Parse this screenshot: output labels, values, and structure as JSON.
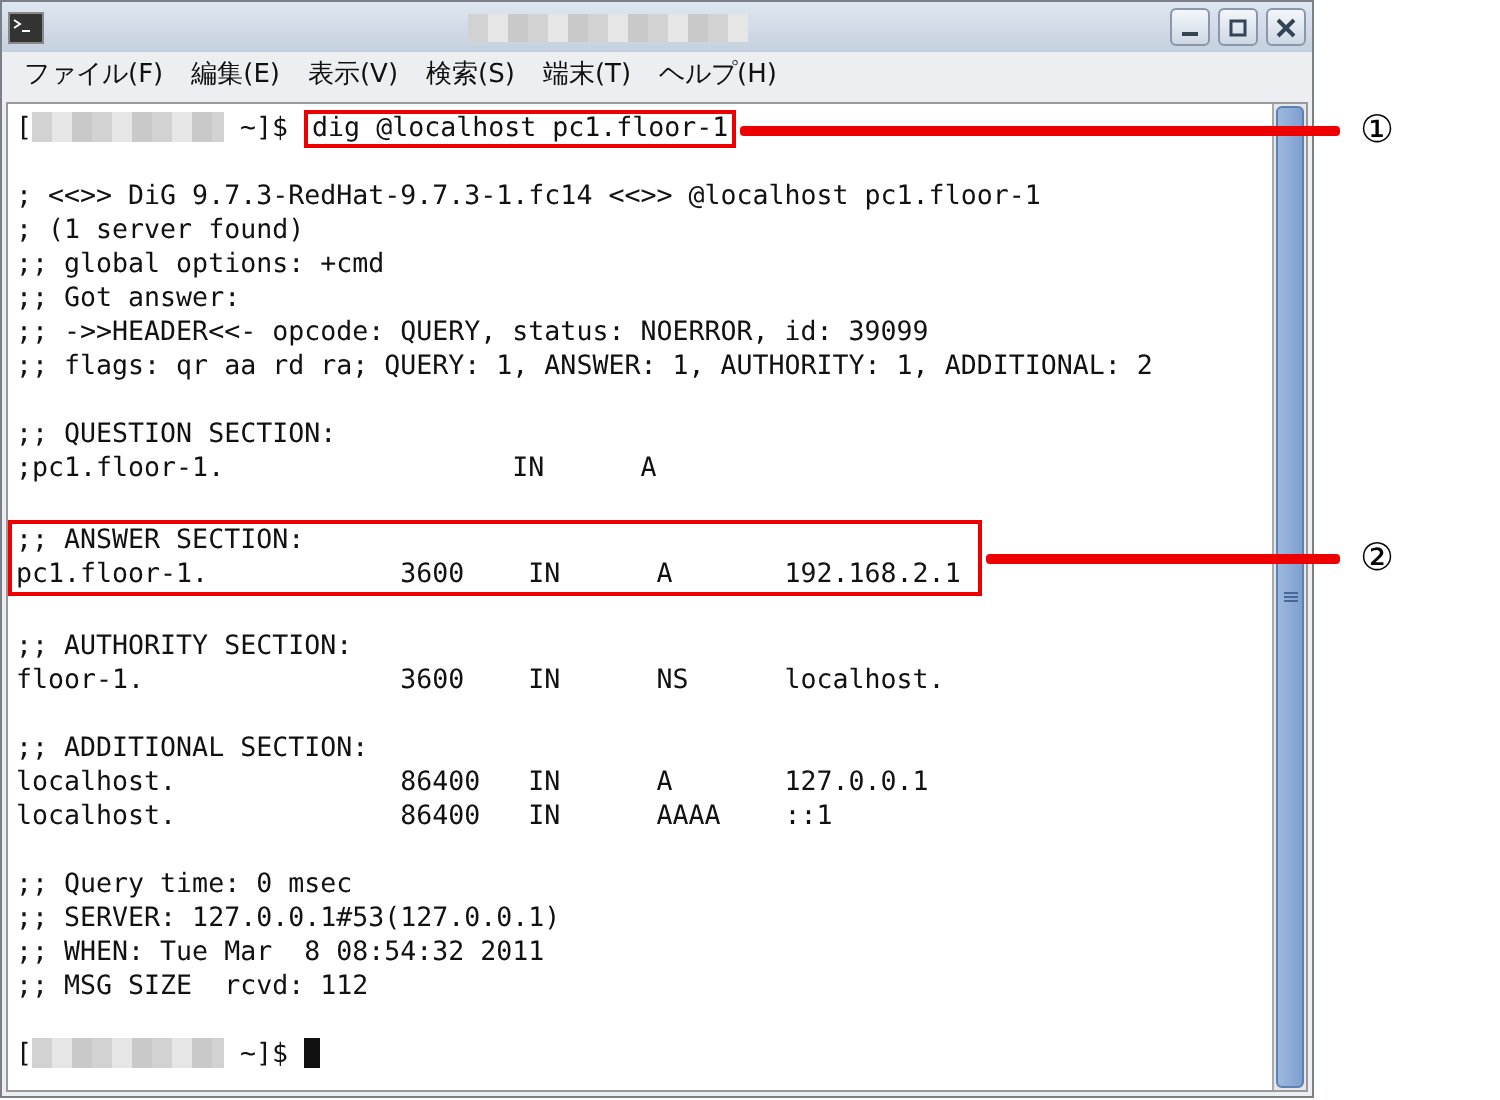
{
  "menu": [
    "ファイル(F)",
    "編集(E)",
    "表示(V)",
    "検索(S)",
    "端末(T)",
    "ヘルプ(H)"
  ],
  "terminal": {
    "command_prompt": {
      "open": "[",
      "suffix": " ~]$ ",
      "command": "dig @localhost pc1.floor-1",
      "callout": "①"
    },
    "blocks": [
      {
        "highlighted": false,
        "lines": [
          "; <<>> DiG 9.7.3-RedHat-9.7.3-1.fc14 <<>> @localhost pc1.floor-1",
          "; (1 server found)",
          ";; global options: +cmd",
          ";; Got answer:",
          ";; ->>HEADER<<- opcode: QUERY, status: NOERROR, id: 39099",
          ";; flags: qr aa rd ra; QUERY: 1, ANSWER: 1, AUTHORITY: 1, ADDITIONAL: 2"
        ]
      },
      {
        "highlighted": false,
        "lines": [
          ";; QUESTION SECTION:",
          ";pc1.floor-1.                  IN      A"
        ]
      },
      {
        "highlighted": true,
        "callout": "②",
        "lines": [
          ";; ANSWER SECTION:",
          "pc1.floor-1.            3600    IN      A       192.168.2.1"
        ]
      },
      {
        "highlighted": false,
        "lines": [
          ";; AUTHORITY SECTION:",
          "floor-1.                3600    IN      NS      localhost."
        ]
      },
      {
        "highlighted": false,
        "lines": [
          ";; ADDITIONAL SECTION:",
          "localhost.              86400   IN      A       127.0.0.1",
          "localhost.              86400   IN      AAAA    ::1"
        ]
      },
      {
        "highlighted": false,
        "lines": [
          ";; Query time: 0 msec",
          ";; SERVER: 127.0.0.1#53(127.0.0.1)",
          ";; WHEN: Tue Mar  8 08:54:32 2011",
          ";; MSG SIZE  rcvd: 112"
        ]
      }
    ],
    "final_prompt": {
      "open": "[",
      "suffix": " ~]$ ",
      "cursor": true
    }
  }
}
